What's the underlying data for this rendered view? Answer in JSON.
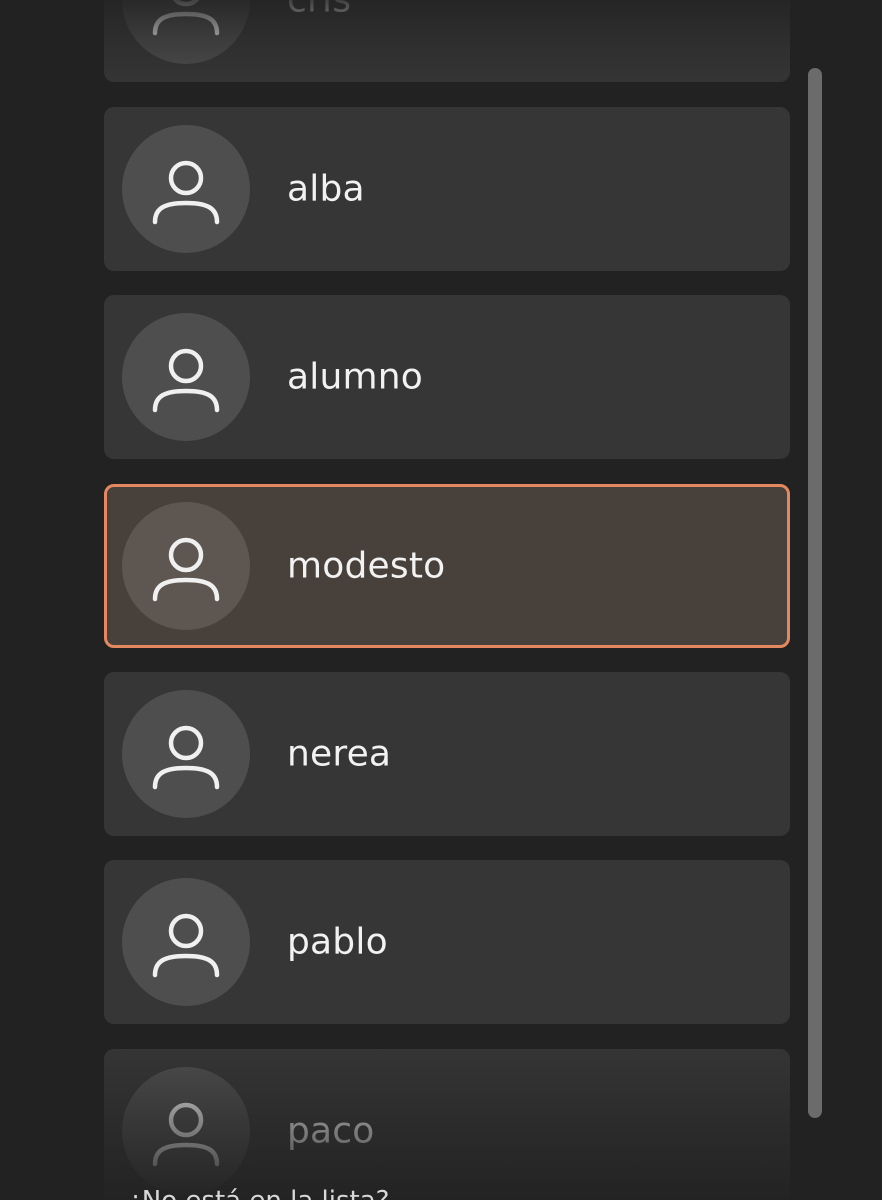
{
  "users": [
    {
      "name": "cris",
      "avatar_icon": "user-icon"
    },
    {
      "name": "alba",
      "avatar_icon": "user-icon"
    },
    {
      "name": "alumno",
      "avatar_icon": "user-icon"
    },
    {
      "name": "modesto",
      "avatar_icon": "user-icon",
      "selected": true
    },
    {
      "name": "nerea",
      "avatar_icon": "user-icon"
    },
    {
      "name": "pablo",
      "avatar_icon": "user-icon"
    },
    {
      "name": "paco",
      "avatar_icon": "user-icon"
    }
  ],
  "not_listed_link": "¿No está en la lista?",
  "colors": {
    "background": "#222222",
    "row": "#363636",
    "selected_row": "#48403b",
    "selected_border": "#e4895f",
    "text": "#f2f2f2"
  }
}
